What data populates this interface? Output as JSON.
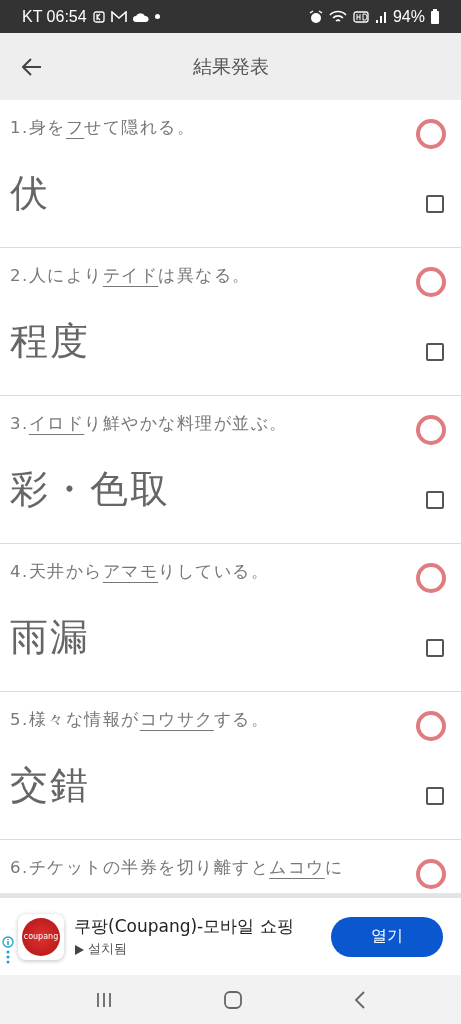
{
  "status_bar": {
    "carrier_time": "KT 06:54",
    "battery": "94%"
  },
  "app_bar": {
    "title": "結果発表"
  },
  "questions": [
    {
      "number": "1.",
      "before": "身を",
      "underlined": "フ",
      "after": "せて隠れる。",
      "answer": "伏",
      "correct": true,
      "checked": false
    },
    {
      "number": "2.",
      "before": "人により",
      "underlined": "テイド",
      "after": "は異なる。",
      "answer": "程度",
      "correct": true,
      "checked": false
    },
    {
      "number": "3.",
      "underlined": "イロド",
      "after": "り鮮やかな料理が並ぶ。",
      "answer": "彩・色取",
      "correct": true,
      "checked": false
    },
    {
      "number": "4.",
      "before": "天井から",
      "underlined": "アマモ",
      "after": "りしている。",
      "answer": "雨漏",
      "correct": true,
      "checked": false
    },
    {
      "number": "5.",
      "before": "様々な情報が",
      "underlined": "コウサク",
      "after": "する。",
      "answer": "交錯",
      "correct": true,
      "checked": false
    },
    {
      "number": "6.",
      "before": "チケットの半券を切り離すと",
      "underlined": "ムコウ",
      "after": "に",
      "correct": true
    }
  ],
  "ad": {
    "logo_text": "coupang",
    "title": "쿠팡(Coupang)-모바일 쇼핑",
    "subtitle": "설치됨",
    "button": "열기"
  }
}
